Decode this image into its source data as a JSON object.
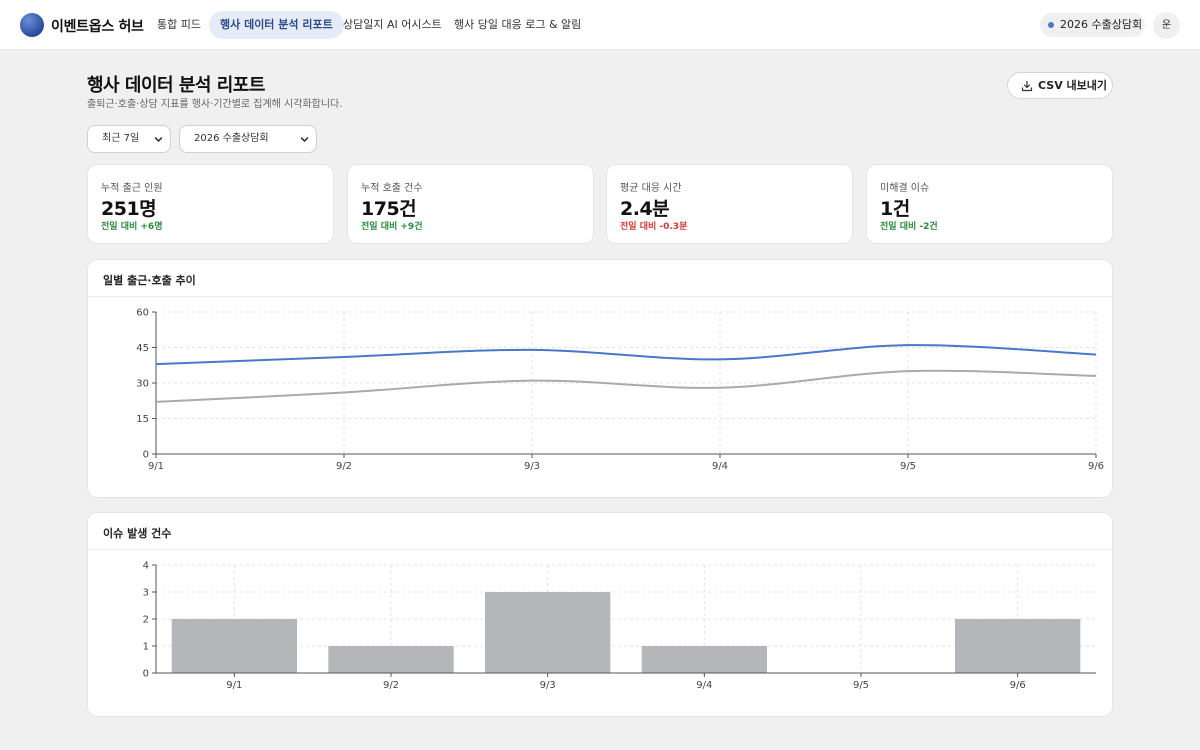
{
  "brand": {
    "name": "이벤트옵스 허브"
  },
  "nav": [
    {
      "label": "통합 피드",
      "active": false
    },
    {
      "label": "행사 데이터 분석 리포트",
      "active": true
    },
    {
      "label": "상담일지 AI 어시스트",
      "active": false
    },
    {
      "label": "행사 당일 대응 로그 & 알림",
      "active": false
    }
  ],
  "header": {
    "event_label": "2026 수출상담회",
    "user_initial": "운"
  },
  "page": {
    "title": "행사 데이터 분석 리포트",
    "subtitle": "출퇴근·호출·상담 지표를 행사·기간별로 집계해 시각화합니다.",
    "export_label": "CSV 내보내기"
  },
  "filters": {
    "period": "최근 7일",
    "event": "2026 수출상담회"
  },
  "kpis": [
    {
      "label": "누적 출근 인원",
      "value": "251명",
      "delta": "전일 대비 +6명",
      "trend": "up"
    },
    {
      "label": "누적 호출 건수",
      "value": "175건",
      "delta": "전일 대비 +9건",
      "trend": "up"
    },
    {
      "label": "평균 대응 시간",
      "value": "2.4분",
      "delta": "전일 대비 -0.3분",
      "trend": "down"
    },
    {
      "label": "미해결 이슈",
      "value": "1건",
      "delta": "전일 대비 -2건",
      "trend": "up"
    }
  ],
  "colors": {
    "accent": "#4a78c8",
    "secondary_line": "#aaaaaa",
    "bar": "#b5b6b9",
    "up": "#2a8a3e",
    "down": "#d23a3a"
  },
  "chart_data": [
    {
      "type": "line",
      "title": "일별 출근·호출 추이",
      "categories": [
        "9/1",
        "9/2",
        "9/3",
        "9/4",
        "9/5",
        "9/6"
      ],
      "series": [
        {
          "values": [
            38,
            41,
            44,
            40,
            46,
            42
          ],
          "color": "#4a78c8"
        },
        {
          "values": [
            22,
            26,
            31,
            28,
            35,
            33
          ],
          "color": "#aaaaaa"
        }
      ],
      "ylim": [
        0,
        60
      ],
      "yticks": [
        0,
        15,
        30,
        45,
        60
      ],
      "grid": true
    },
    {
      "type": "bar",
      "title": "이슈 발생 건수",
      "categories": [
        "9/1",
        "9/2",
        "9/3",
        "9/4",
        "9/5",
        "9/6"
      ],
      "values": [
        2,
        1,
        3,
        1,
        0,
        2
      ],
      "ylim": [
        0,
        4
      ],
      "yticks": [
        0,
        1,
        2,
        3,
        4
      ],
      "grid": true
    }
  ]
}
